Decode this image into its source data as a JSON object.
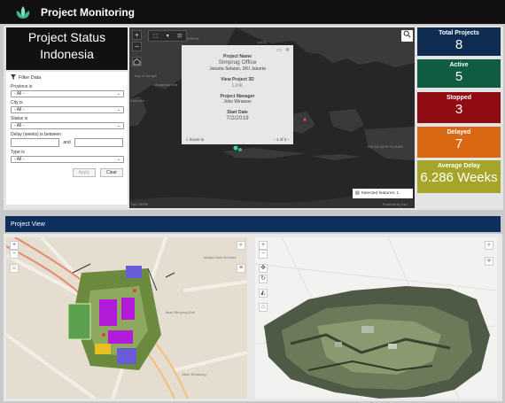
{
  "app": {
    "title": "Project Monitoring"
  },
  "status": {
    "line1": "Project Status",
    "line2": "Indonesia"
  },
  "filter": {
    "header": "Filter Data",
    "province_label": "Province is",
    "city_label": "City is",
    "status_label": "Status is",
    "delay_label": "Delay (weeks) is between",
    "and_label": "and",
    "type_label": "Type is",
    "all_option": "- All -",
    "apply_label": "Apply",
    "clear_label": "Clear"
  },
  "popup": {
    "project_name_label": "Project Name",
    "project_name": "Simprug Office",
    "location": "Jakarta Selatan, DKI Jakarta",
    "view3d_label": "View Project 3D",
    "view3d_link": "Link",
    "manager_label": "Project Manager",
    "manager": "Joko Wirawan",
    "start_label": "Start Date",
    "start_date": "7/2/2019",
    "zoom_to": "Zoom to",
    "pager": "1 of 2"
  },
  "map": {
    "selected_features": "Selected features: 1",
    "attribution_left": "Esri, HERE",
    "attribution_right": "Powered by Esri",
    "labels": [
      "BURMA",
      "LAOS",
      "Bay of Bengal",
      "Colombo",
      "MALAYSIA",
      "PAPUA NEW GUINEA",
      "Andaman Sea"
    ]
  },
  "kpis": [
    {
      "label": "Total Projects",
      "value": "8",
      "color": "#0f2d52"
    },
    {
      "label": "Active",
      "value": "5",
      "color": "#0e5c44"
    },
    {
      "label": "Stopped",
      "value": "3",
      "color": "#8f0d12"
    },
    {
      "label": "Delayed",
      "value": "7",
      "color": "#d96815"
    },
    {
      "label": "Average Delay",
      "value": "6.286 Weeks",
      "color": "#a5a629"
    }
  ],
  "project_view": {
    "title": "Project View"
  },
  "view2d": {
    "labels": [
      "Jalan Simprug Golf",
      "Jalan Sinabung",
      "Masjid Jami Al-Huda"
    ]
  }
}
